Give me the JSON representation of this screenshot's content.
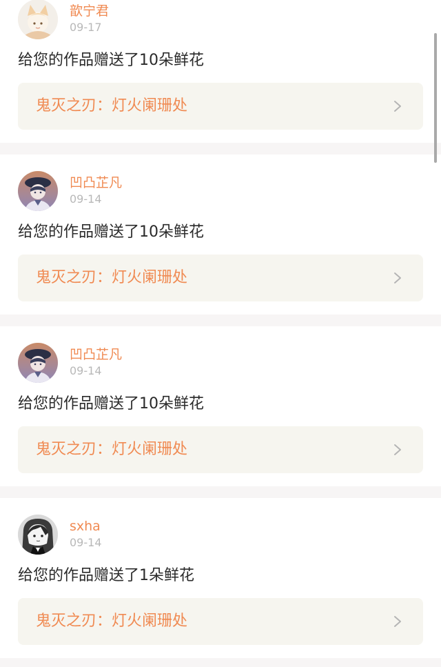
{
  "notifications": [
    {
      "username": "歆宁君",
      "date": "09-17",
      "message": "给您的作品赠送了10朵鲜花",
      "work_title": "鬼灭之刃：灯火阑珊处",
      "avatar_icon": "fox-girl-avatar"
    },
    {
      "username": "凹凸芷凡",
      "date": "09-14",
      "message": "给您的作品赠送了10朵鲜花",
      "work_title": "鬼灭之刃：灯火阑珊处",
      "avatar_icon": "capped-character-avatar"
    },
    {
      "username": "凹凸芷凡",
      "date": "09-14",
      "message": "给您的作品赠送了10朵鲜花",
      "work_title": "鬼灭之刃：灯火阑珊处",
      "avatar_icon": "capped-character-avatar"
    },
    {
      "username": "sxha",
      "date": "09-14",
      "message": "给您的作品赠送了1朵鲜花",
      "work_title": "鬼灭之刃：灯火阑珊处",
      "avatar_icon": "manga-girl-avatar"
    }
  ],
  "colors": {
    "accent": "#f08a52",
    "date_gray": "#b8b8b8",
    "link_bg": "#f6f5ef",
    "separator": "#f7f5f5"
  }
}
